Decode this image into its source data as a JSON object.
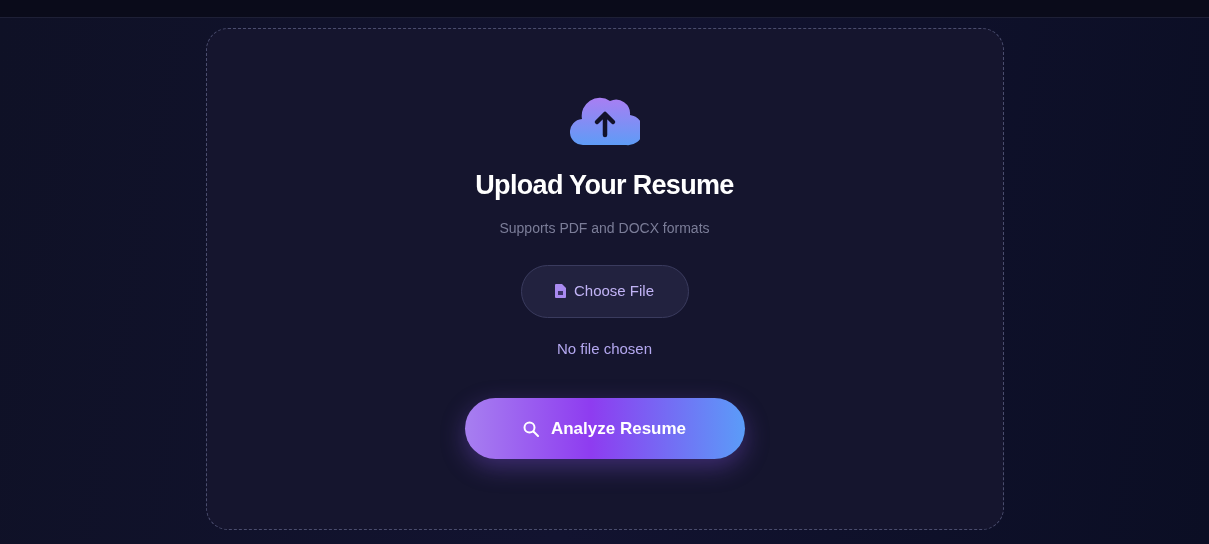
{
  "upload_card": {
    "title": "Upload Your Resume",
    "subtitle": "Supports PDF and DOCX formats",
    "file_button": {
      "label": "Choose File"
    },
    "file_status": "No file chosen",
    "submit_button": {
      "label": "Analyze Resume"
    }
  }
}
